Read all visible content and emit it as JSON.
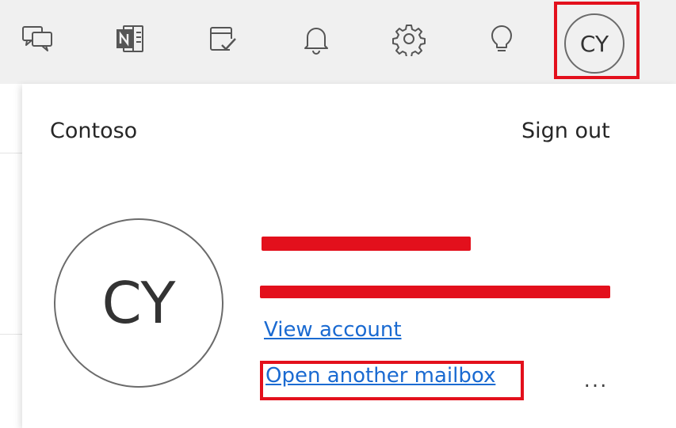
{
  "toolbar": {
    "icons": [
      {
        "name": "feedback-icon"
      },
      {
        "name": "onenote-icon"
      },
      {
        "name": "todo-icon"
      },
      {
        "name": "bell-icon"
      },
      {
        "name": "gear-icon"
      },
      {
        "name": "lightbulb-icon"
      }
    ],
    "avatar_initials": "CY"
  },
  "account_flyout": {
    "org_name": "Contoso",
    "sign_out_label": "Sign out",
    "avatar_initials": "CY",
    "view_account_label": "View account",
    "open_mailbox_label": "Open another mailbox",
    "more_label": "..."
  },
  "colors": {
    "highlight": "#e3101c",
    "link": "#1a6ad1",
    "toolbar_bg": "#f0f0f0"
  }
}
